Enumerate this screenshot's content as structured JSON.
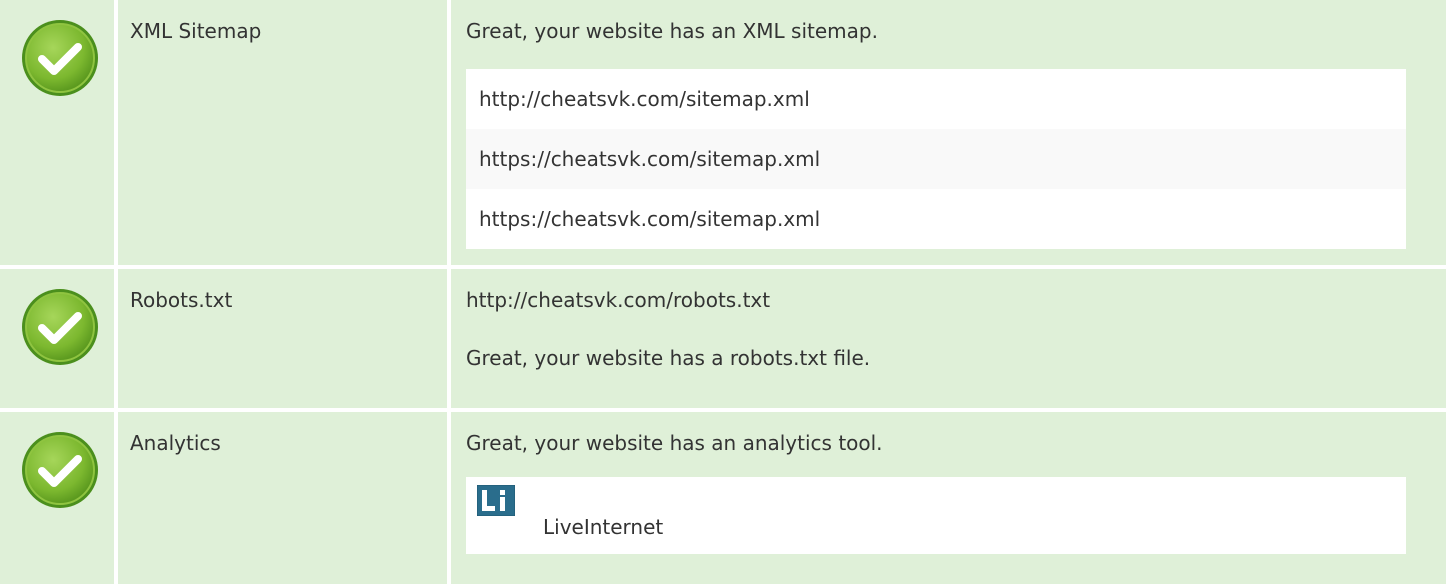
{
  "rows": [
    {
      "name": "XML Sitemap",
      "status_icon": "check-circle-icon",
      "message": "Great, your website has an XML sitemap.",
      "urls": [
        "http://cheatsvk.com/sitemap.xml",
        "https://cheatsvk.com/sitemap.xml",
        "https://cheatsvk.com/sitemap.xml"
      ]
    },
    {
      "name": "Robots.txt",
      "status_icon": "check-circle-icon",
      "url": "http://cheatsvk.com/robots.txt",
      "message": "Great, your website has a robots.txt file."
    },
    {
      "name": "Analytics",
      "status_icon": "check-circle-icon",
      "message": "Great, your website has an analytics tool.",
      "tools": [
        {
          "name": "LiveInternet",
          "logo_text": "Li",
          "icon": "liveinternet-logo-icon"
        }
      ]
    }
  ],
  "colors": {
    "row_background": "#dff0d8",
    "check_green": "#7cb82f",
    "check_dark_green": "#4b8f1d",
    "list_background": "#ffffff",
    "list_alt_background": "#f9f9f9",
    "logo_blue": "#2a6d8c"
  }
}
